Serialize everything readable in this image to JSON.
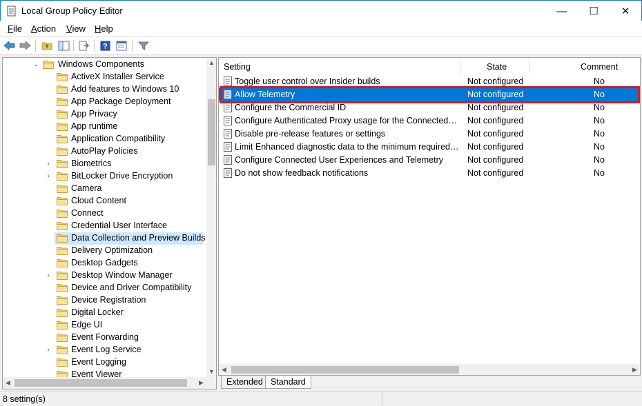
{
  "window": {
    "title": "Local Group Policy Editor",
    "minimize_glyph": "—",
    "maximize_glyph": "☐",
    "close_glyph": "✕"
  },
  "menu": [
    {
      "label": "File",
      "accel": "F",
      "rest": "ile"
    },
    {
      "label": "Action",
      "accel": "A",
      "rest": "ction"
    },
    {
      "label": "View",
      "accel": "V",
      "rest": "iew"
    },
    {
      "label": "Help",
      "accel": "H",
      "rest": "elp"
    }
  ],
  "toolbar": {
    "icons": [
      "back-arrow-icon",
      "forward-arrow-icon",
      "up-folder-icon",
      "show-hide-tree-icon",
      "export-list-icon",
      "help-icon",
      "properties-icon",
      "filter-icon"
    ]
  },
  "tree": {
    "root": {
      "label": "Windows Components",
      "expanded": true
    },
    "items": [
      {
        "label": "ActiveX Installer Service",
        "expandable": false
      },
      {
        "label": "Add features to Windows 10",
        "expandable": false
      },
      {
        "label": "App Package Deployment",
        "expandable": false
      },
      {
        "label": "App Privacy",
        "expandable": false
      },
      {
        "label": "App runtime",
        "expandable": false
      },
      {
        "label": "Application Compatibility",
        "expandable": false
      },
      {
        "label": "AutoPlay Policies",
        "expandable": false
      },
      {
        "label": "Biometrics",
        "expandable": true
      },
      {
        "label": "BitLocker Drive Encryption",
        "expandable": true
      },
      {
        "label": "Camera",
        "expandable": false
      },
      {
        "label": "Cloud Content",
        "expandable": false
      },
      {
        "label": "Connect",
        "expandable": false
      },
      {
        "label": "Credential User Interface",
        "expandable": false
      },
      {
        "label": "Data Collection and Preview Builds",
        "expandable": false,
        "selected": true
      },
      {
        "label": "Delivery Optimization",
        "expandable": false
      },
      {
        "label": "Desktop Gadgets",
        "expandable": false
      },
      {
        "label": "Desktop Window Manager",
        "expandable": true
      },
      {
        "label": "Device and Driver Compatibility",
        "expandable": false
      },
      {
        "label": "Device Registration",
        "expandable": false
      },
      {
        "label": "Digital Locker",
        "expandable": false
      },
      {
        "label": "Edge UI",
        "expandable": false
      },
      {
        "label": "Event Forwarding",
        "expandable": false
      },
      {
        "label": "Event Log Service",
        "expandable": true
      },
      {
        "label": "Event Logging",
        "expandable": false
      },
      {
        "label": "Event Viewer",
        "expandable": false
      }
    ]
  },
  "list": {
    "columns": {
      "setting": "Setting",
      "state": "State",
      "comment": "Comment"
    },
    "rows": [
      {
        "setting": "Toggle user control over Insider builds",
        "state": "Not configured",
        "comment": "No"
      },
      {
        "setting": "Allow Telemetry",
        "state": "Not configured",
        "comment": "No",
        "selected": true
      },
      {
        "setting": "Configure the Commercial ID",
        "state": "Not configured",
        "comment": "No"
      },
      {
        "setting": "Configure Authenticated Proxy usage for the Connected Us...",
        "state": "Not configured",
        "comment": "No"
      },
      {
        "setting": "Disable pre-release features or settings",
        "state": "Not configured",
        "comment": "No"
      },
      {
        "setting": "Limit Enhanced diagnostic data to the minimum required b...",
        "state": "Not configured",
        "comment": "No"
      },
      {
        "setting": "Configure Connected User Experiences and Telemetry",
        "state": "Not configured",
        "comment": "No"
      },
      {
        "setting": "Do not show feedback notifications",
        "state": "Not configured",
        "comment": "No"
      }
    ]
  },
  "tabs": [
    {
      "label": "Extended",
      "active": false
    },
    {
      "label": "Standard",
      "active": true
    }
  ],
  "status": {
    "text": "8 setting(s)"
  },
  "colors": {
    "selection": "#0078d7",
    "tree_selection": "#cce8ff",
    "highlight_border": "#d71920"
  }
}
